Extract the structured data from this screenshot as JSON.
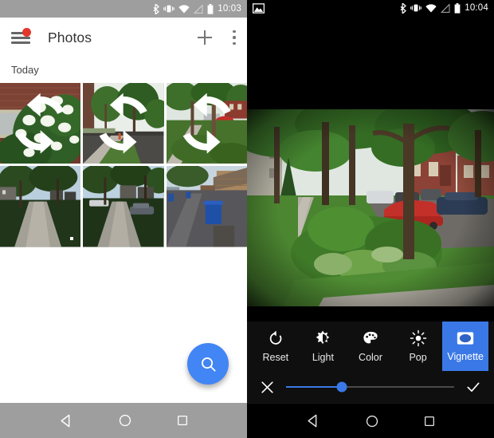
{
  "left_phone": {
    "statusbar": {
      "time": "10:03",
      "icons": [
        "bluetooth-icon",
        "vibrate-icon",
        "wifi-icon",
        "signal-off-icon",
        "battery-icon"
      ],
      "background": "#9e9e9e"
    },
    "appbar": {
      "menu_icon": "hamburger-menu-icon",
      "has_notification_badge": true,
      "badge_color": "#e2382c",
      "title": "Photos",
      "add_label": "+",
      "overflow_label": "⋮"
    },
    "section": {
      "label": "Today"
    },
    "grid": {
      "columns": 3,
      "items": [
        {
          "description": "White hydrangea bush against brick house",
          "badge": "sync-icon"
        },
        {
          "description": "Tree-lined street with fire hydrant",
          "badge": "sync-icon"
        },
        {
          "description": "Sidewalk with red car and brick houses",
          "badge": "sync-icon"
        },
        {
          "description": "Sidewalk path through green lawn at dusk",
          "badge": "dot-marker"
        },
        {
          "description": "Residential street with parked cars",
          "badge": null
        },
        {
          "description": "Alley with blue recycling bins and brick garage",
          "badge": null
        }
      ]
    },
    "fab": {
      "icon": "search-icon",
      "color": "#4285f4"
    },
    "navbar": {
      "background": "#9e9e9e",
      "buttons": [
        "back-icon",
        "home-icon",
        "recents-icon"
      ]
    }
  },
  "right_phone": {
    "statusbar": {
      "time": "10:04",
      "notification_icon": "photo-icon",
      "icons": [
        "bluetooth-icon",
        "vibrate-icon",
        "wifi-icon",
        "signal-off-icon",
        "battery-icon"
      ],
      "background": "#000000"
    },
    "preview": {
      "description": "Sidewalk scene with trees, green plantings and a red car, vignette applied"
    },
    "toolbar": {
      "accent_color": "#3b78e7",
      "tools": [
        {
          "label": "Reset",
          "icon": "undo-icon",
          "active": false
        },
        {
          "label": "Light",
          "icon": "brightness-icon",
          "active": false
        },
        {
          "label": "Color",
          "icon": "palette-icon",
          "active": false
        },
        {
          "label": "Pop",
          "icon": "sunburst-icon",
          "active": false
        },
        {
          "label": "Vignette",
          "icon": "vignette-icon",
          "active": true
        }
      ]
    },
    "slider": {
      "value_percent": 33,
      "cancel_icon": "close-icon",
      "confirm_icon": "check-icon",
      "fill_color": "#3b78e7"
    },
    "navbar": {
      "background": "#000000",
      "buttons": [
        "back-icon",
        "home-icon",
        "recents-icon"
      ]
    }
  }
}
